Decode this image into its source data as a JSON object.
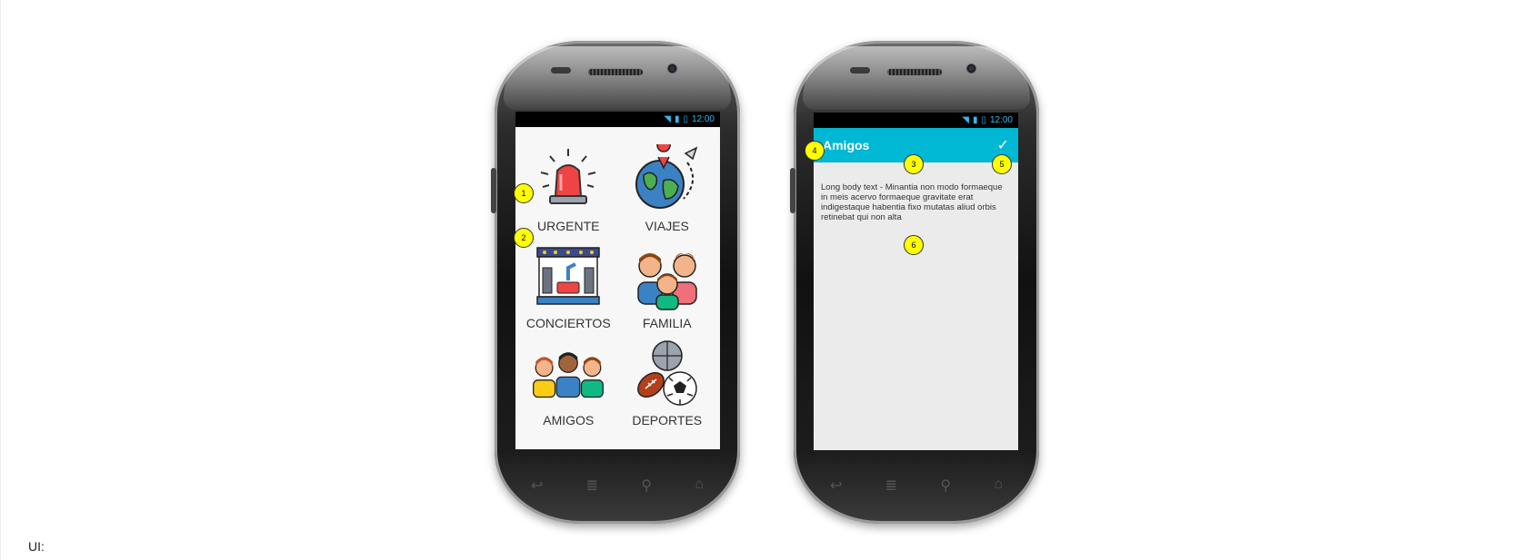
{
  "left_phone": {
    "status_time": "12:00",
    "tiles": [
      {
        "label": "URGENTE",
        "icon": "siren-icon"
      },
      {
        "label": "VIAJES",
        "icon": "globe-plane-icon"
      },
      {
        "label": "CONCIERTOS",
        "icon": "concert-stage-icon"
      },
      {
        "label": "FAMILIA",
        "icon": "family-icon"
      },
      {
        "label": "AMIGOS",
        "icon": "friends-icon"
      },
      {
        "label": "DEPORTES",
        "icon": "sports-balls-icon"
      }
    ]
  },
  "right_phone": {
    "status_time": "12:00",
    "title": "Amigos",
    "body": "Long body text - Minantia non modo formaeque in meis acervo formaeque gravitate erat indigestaque habentia fixo mutatas aliud orbis retinebat qui non alta"
  },
  "markers": [
    "1",
    "2",
    "3",
    "4",
    "5",
    "6"
  ],
  "caption": "UI:",
  "colors": {
    "appbar": "#00b7d4",
    "marker": "#ffff00",
    "status_text": "#38b6e8"
  }
}
